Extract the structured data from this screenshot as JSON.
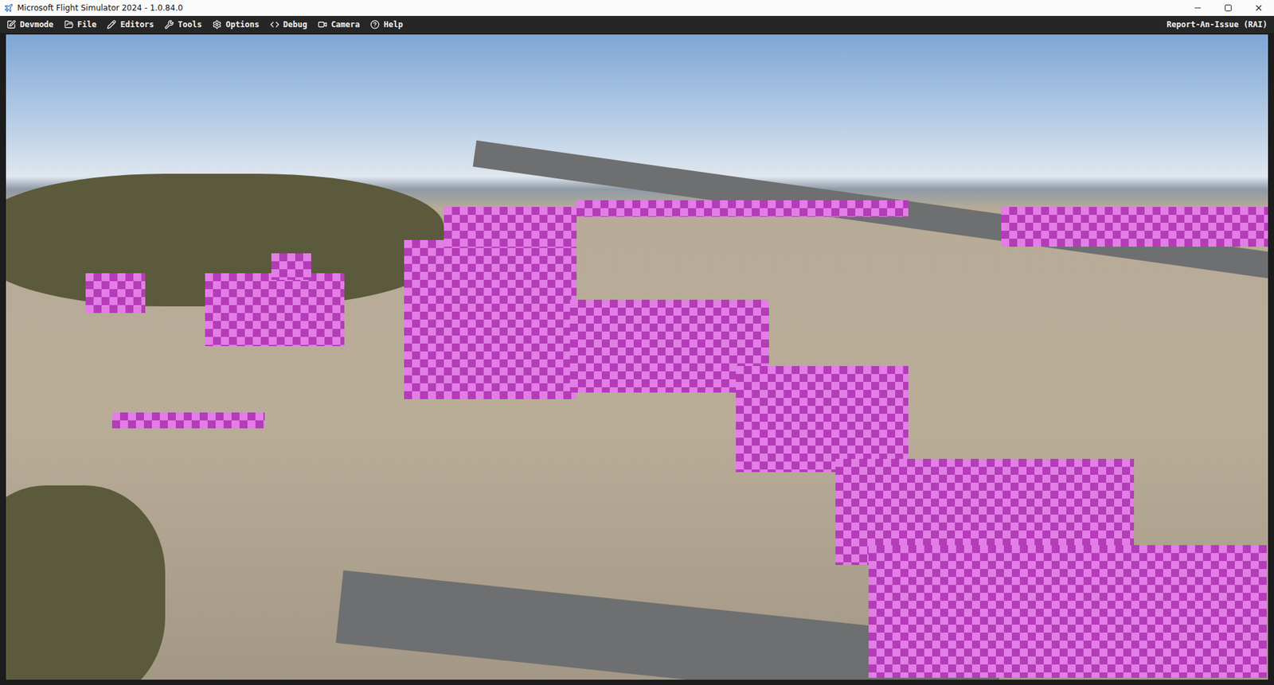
{
  "window": {
    "title": "Microsoft Flight Simulator 2024 - 1.0.84.0"
  },
  "menu": {
    "items": [
      {
        "label": "Devmode"
      },
      {
        "label": "File"
      },
      {
        "label": "Editors"
      },
      {
        "label": "Tools"
      },
      {
        "label": "Options"
      },
      {
        "label": "Debug"
      },
      {
        "label": "Camera"
      },
      {
        "label": "Help"
      }
    ],
    "right": "Report-An-Issue (RAI)"
  }
}
